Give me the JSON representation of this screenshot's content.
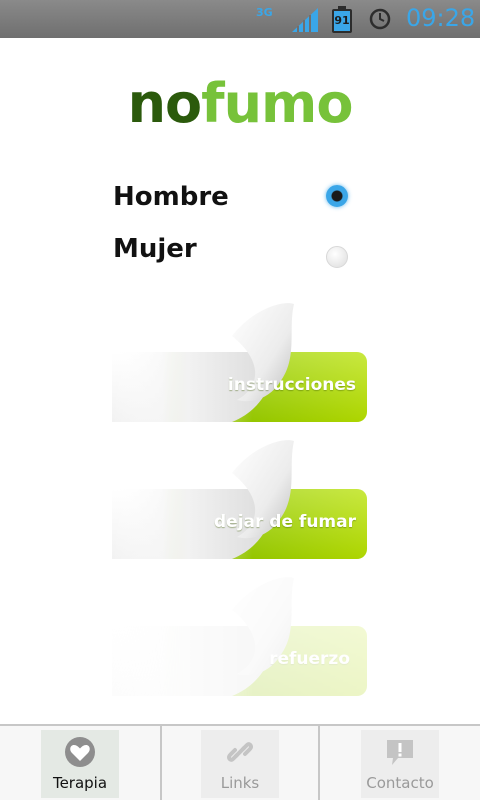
{
  "status_bar": {
    "network": "3G",
    "battery": "91",
    "time": "09:28"
  },
  "logo": {
    "part1": "no",
    "part2": "fumo"
  },
  "gender": {
    "options": [
      {
        "label": "Hombre",
        "selected": true
      },
      {
        "label": "Mujer",
        "selected": false
      }
    ]
  },
  "menu": {
    "instructions_label": "instrucciones",
    "quit_label": "dejar de fumar",
    "reinforcement_label": "refuerzo"
  },
  "bottom_nav": {
    "items": [
      {
        "label": "Terapia",
        "icon": "heart-icon",
        "active": true
      },
      {
        "label": "Links",
        "icon": "link-icon",
        "active": false
      },
      {
        "label": "Contacto",
        "icon": "speech-bubble-icon",
        "active": false
      }
    ]
  },
  "colors": {
    "accent_blue": "#3aa6e8",
    "logo_dark_green": "#2b5a0c",
    "logo_light_green": "#77c23a",
    "sticker_green": "#a8d800"
  }
}
